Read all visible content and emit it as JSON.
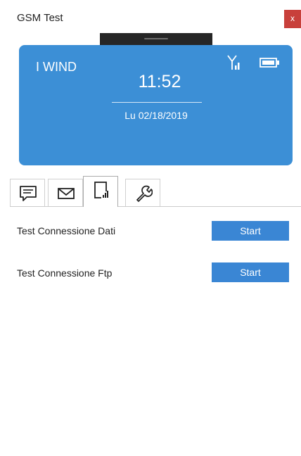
{
  "window": {
    "title": "GSM Test",
    "close_label": "x"
  },
  "phone": {
    "operator": "I WIND",
    "time": "11:52",
    "date": "Lu 02/18/2019",
    "signal_icon": "antenna-signal-icon",
    "battery_icon": "battery-icon",
    "panel_color": "#3c8fd6"
  },
  "tabs": [
    {
      "icon": "message-icon",
      "selected": false
    },
    {
      "icon": "mail-icon",
      "selected": false
    },
    {
      "icon": "phone-signal-icon",
      "selected": true
    },
    {
      "icon": "wrench-icon",
      "selected": false
    }
  ],
  "tests": [
    {
      "label": "Test Connessione Dati",
      "button_label": "Start"
    },
    {
      "label": "Test Connessione Ftp",
      "button_label": "Start"
    }
  ],
  "colors": {
    "accent": "#3a86d4",
    "close": "#c8403b"
  }
}
